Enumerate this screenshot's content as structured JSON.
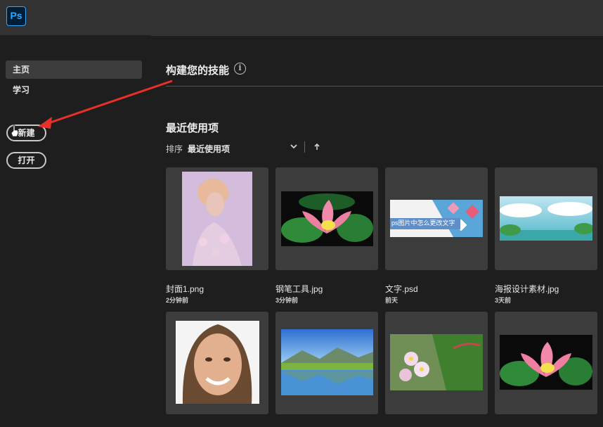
{
  "app": {
    "logo_text": "Ps",
    "accent": "#31a8ff"
  },
  "sidebar": {
    "items": [
      {
        "label": "主页",
        "active": true
      },
      {
        "label": "学习",
        "active": false
      }
    ],
    "new_button": "新建",
    "open_button": "打开"
  },
  "main": {
    "skills_title": "构建您的技能",
    "info_icon": "i",
    "recent_title": "最近使用项",
    "sort_label": "排序",
    "sort_value": "最近使用项",
    "files": [
      {
        "name": "封面1.png",
        "time": "2分钟前"
      },
      {
        "name": "钢笔工具.jpg",
        "time": "3分钟前"
      },
      {
        "name": "文字.psd",
        "time": "前天"
      },
      {
        "name": "海报设计素材.jpg",
        "time": "3天前"
      }
    ],
    "banner_text": "ps图片中怎么更改文字"
  },
  "annotation": {
    "arrow_color": "#e8302a"
  }
}
